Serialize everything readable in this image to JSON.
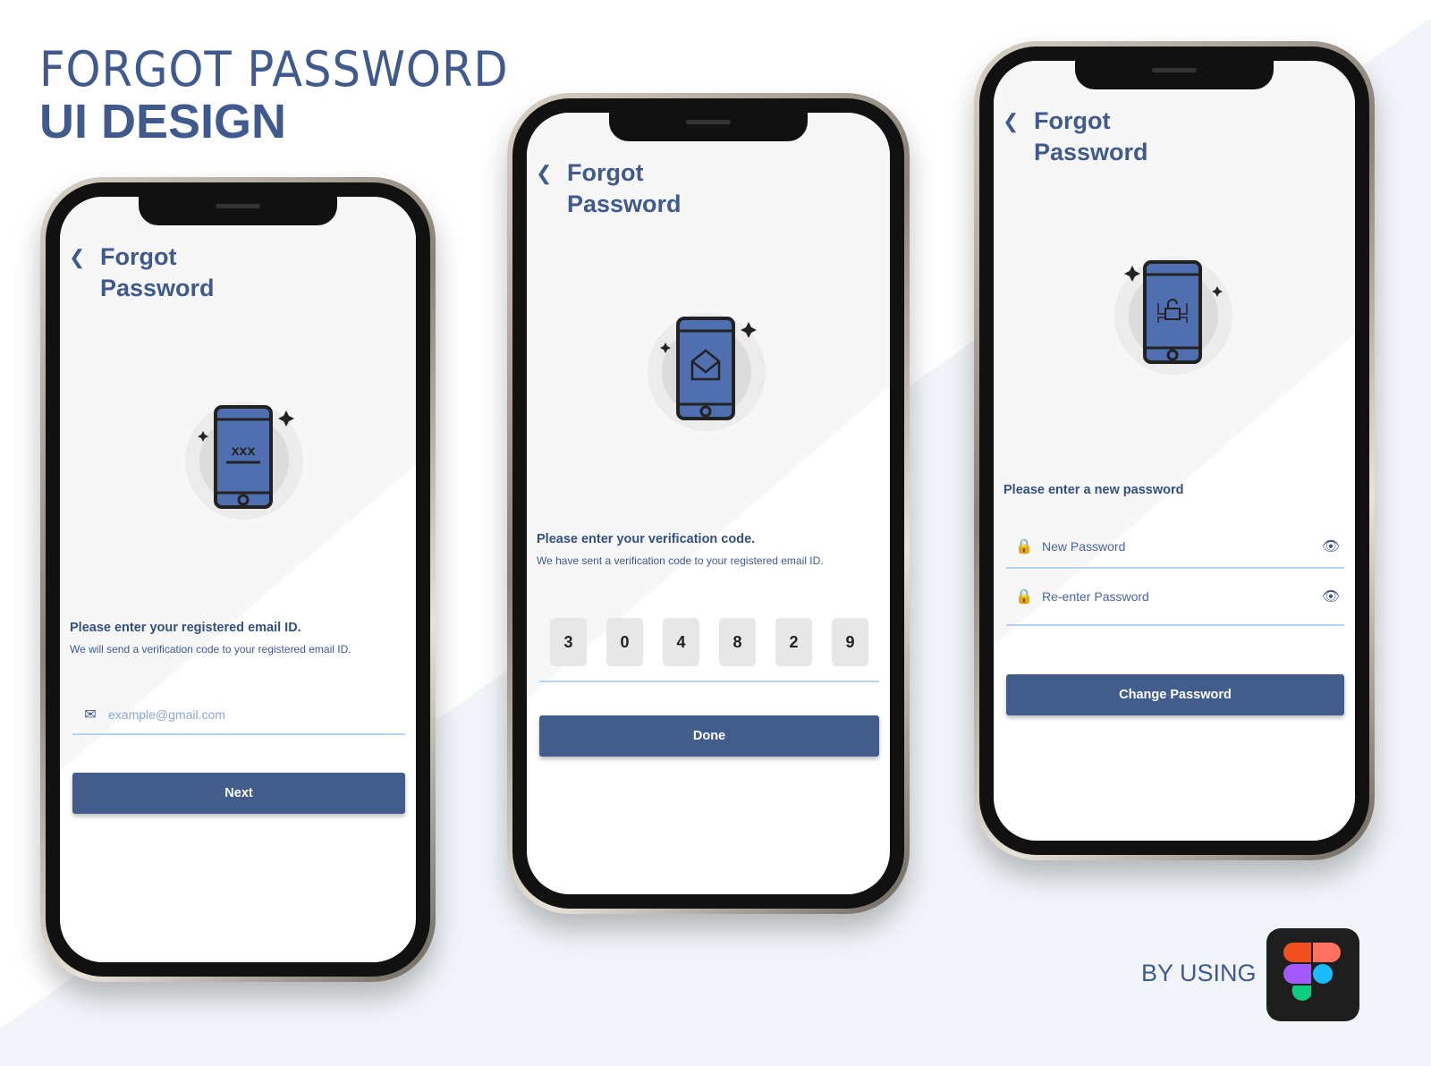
{
  "headline": {
    "line1": "FORGOT PASSWORD",
    "line2": "UI DESIGN"
  },
  "footer": {
    "by_using": "BY USING",
    "tool_logo": "figma-logo"
  },
  "screens": [
    {
      "back_icon": "chevron-left-icon",
      "title_line1": "Forgot",
      "title_line2": "Password",
      "illustration": "phone-password-icon",
      "heading": "Please enter your registered email ID.",
      "subtext": "We will send a verification code to your registered email ID.",
      "email_field": {
        "icon": "envelope-icon",
        "placeholder": "example@gmail.com",
        "value": ""
      },
      "button_label": "Next"
    },
    {
      "back_icon": "chevron-left-icon",
      "title_line1": "Forgot",
      "title_line2": "Password",
      "illustration": "phone-mail-icon",
      "heading": "Please enter your verification code.",
      "subtext": "We have sent a verification code to your registered email ID.",
      "code_digits": [
        "3",
        "0",
        "4",
        "8",
        "2",
        "9"
      ],
      "button_label": "Done"
    },
    {
      "back_icon": "chevron-left-icon",
      "title_line1": "Forgot",
      "title_line2": "Password",
      "illustration": "phone-unlock-icon",
      "heading": "Please enter a new password",
      "new_password_field": {
        "icon": "lock-icon",
        "placeholder": "New Password",
        "toggle_icon": "eye-icon"
      },
      "reenter_password_field": {
        "icon": "lock-icon",
        "placeholder": "Re-enter Password",
        "toggle_icon": "eye-icon"
      },
      "button_label": "Change Password"
    }
  ],
  "colors": {
    "brand": "#425c8c",
    "title": "#405a8e",
    "underline": "#b4d2f4",
    "code_box": "#e7e7e7"
  }
}
